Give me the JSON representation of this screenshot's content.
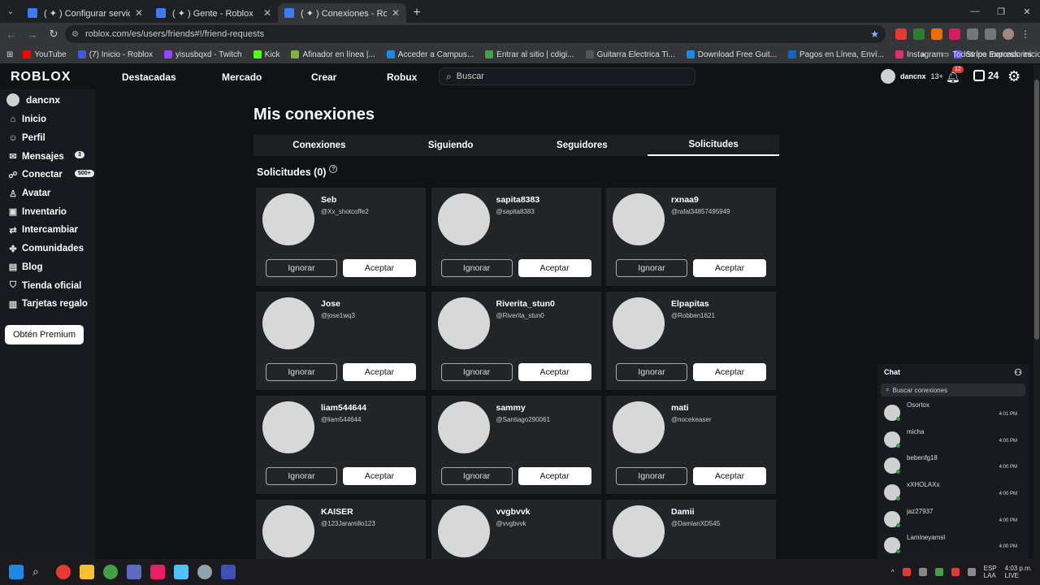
{
  "browser": {
    "tabs": [
      {
        "label": "( ✦ ) Configurar servidor privad",
        "active": false
      },
      {
        "label": "( ✦ ) Gente - Roblox",
        "active": false
      },
      {
        "label": "( ✦ ) Conexiones - Roblox",
        "active": true
      }
    ],
    "url": "roblox.com/es/users/friends#!/friend-requests",
    "bookmarks": [
      {
        "label": "YouTube",
        "color": "#ff0000"
      },
      {
        "label": "(7) Inicio - Roblox",
        "color": "#3b5bdb"
      },
      {
        "label": "yisusbqxd - Twitch",
        "color": "#9146ff"
      },
      {
        "label": "Kick",
        "color": "#53fc18"
      },
      {
        "label": "Afinador en línea |...",
        "color": "#7cb342"
      },
      {
        "label": "Acceder a Campus...",
        "color": "#1e88e5"
      },
      {
        "label": "Entrar al sitio | cdigi...",
        "color": "#43a047"
      },
      {
        "label": "Guitarra Electrica Ti...",
        "color": "#555555"
      },
      {
        "label": "Download Free Guit...",
        "color": "#1e88e5"
      },
      {
        "label": "Pagos en Línea, Enví...",
        "color": "#1565c0"
      },
      {
        "label": "Instagram",
        "color": "#e1306c"
      },
      {
        "label": "Stripe Express: inicio...",
        "color": "#635bff"
      }
    ],
    "bookmarks_more": "»",
    "all_bookmarks": "Todos los marcadores"
  },
  "header": {
    "logo": "ROBLOX",
    "nav": [
      "Destacadas",
      "Mercado",
      "Crear",
      "Robux"
    ],
    "search_placeholder": "Buscar",
    "username": "dancnx",
    "age": "13+",
    "notifications": "12",
    "robux": "24"
  },
  "sidebar": {
    "username": "dancnx",
    "items": [
      {
        "label": "Inicio",
        "icon": "home-icon",
        "glyph": "⌂"
      },
      {
        "label": "Perfil",
        "icon": "profile-icon",
        "glyph": "☺"
      },
      {
        "label": "Mensajes",
        "icon": "messages-icon",
        "glyph": "✉",
        "count": "3"
      },
      {
        "label": "Conectar",
        "icon": "connect-icon",
        "glyph": "☍",
        "count": "500+"
      },
      {
        "label": "Avatar",
        "icon": "avatar-icon",
        "glyph": "♙"
      },
      {
        "label": "Inventario",
        "icon": "inventory-icon",
        "glyph": "▣"
      },
      {
        "label": "Intercambiar",
        "icon": "trade-icon",
        "glyph": "⇄"
      },
      {
        "label": "Comunidades",
        "icon": "communities-icon",
        "glyph": "✤"
      },
      {
        "label": "Blog",
        "icon": "blog-icon",
        "glyph": "▤"
      },
      {
        "label": "Tienda oficial",
        "icon": "shop-icon",
        "glyph": "⛉"
      },
      {
        "label": "Tarjetas regalo",
        "icon": "gift-card-icon",
        "glyph": "▥"
      }
    ],
    "premium_label": "Obtén Premium"
  },
  "main": {
    "title": "Mis conexiones",
    "tabs": [
      "Conexiones",
      "Siguiendo",
      "Seguidores",
      "Solicitudes"
    ],
    "active_tab": 3,
    "requests_heading": "Solicitudes (0)",
    "ignore_label": "Ignorar",
    "accept_label": "Aceptar",
    "requests": [
      {
        "name": "Seb",
        "handle": "@Xx_shotcoffe2"
      },
      {
        "name": "sapita8383",
        "handle": "@sapita8383"
      },
      {
        "name": "rxnaa9",
        "handle": "@rafal34857495949"
      },
      {
        "name": "Jose",
        "handle": "@jose1wq3"
      },
      {
        "name": "Riverita_stun0",
        "handle": "@Riverita_stun0"
      },
      {
        "name": "Elpapitas",
        "handle": "@Robben1621"
      },
      {
        "name": "liam544644",
        "handle": "@liam544644"
      },
      {
        "name": "sammy",
        "handle": "@Santiago290061"
      },
      {
        "name": "mati",
        "handle": "@nocekeaser"
      },
      {
        "name": "KAISER",
        "handle": "@123Jaramillo123"
      },
      {
        "name": "vvgbvvk",
        "handle": "@vvgbvvk"
      },
      {
        "name": "Damii",
        "handle": "@DamianXD545"
      }
    ]
  },
  "chat": {
    "title": "Chat",
    "search_placeholder": "Buscar conexiones",
    "contacts": [
      {
        "name": "Osortox",
        "time": "4:01 PM"
      },
      {
        "name": "micha",
        "time": "4:00 PM"
      },
      {
        "name": "bebenfg18",
        "time": "4:00 PM"
      },
      {
        "name": "xXHOLAXx",
        "time": "4:00 PM"
      },
      {
        "name": "jaz27937",
        "time": "4:00 PM"
      },
      {
        "name": "Lamineyamsl",
        "time": "4:00 PM"
      }
    ]
  },
  "taskbar": {
    "lang": "ESP",
    "lang2": "LAA",
    "time": "4:03 p.m.",
    "live": "LIVE"
  }
}
